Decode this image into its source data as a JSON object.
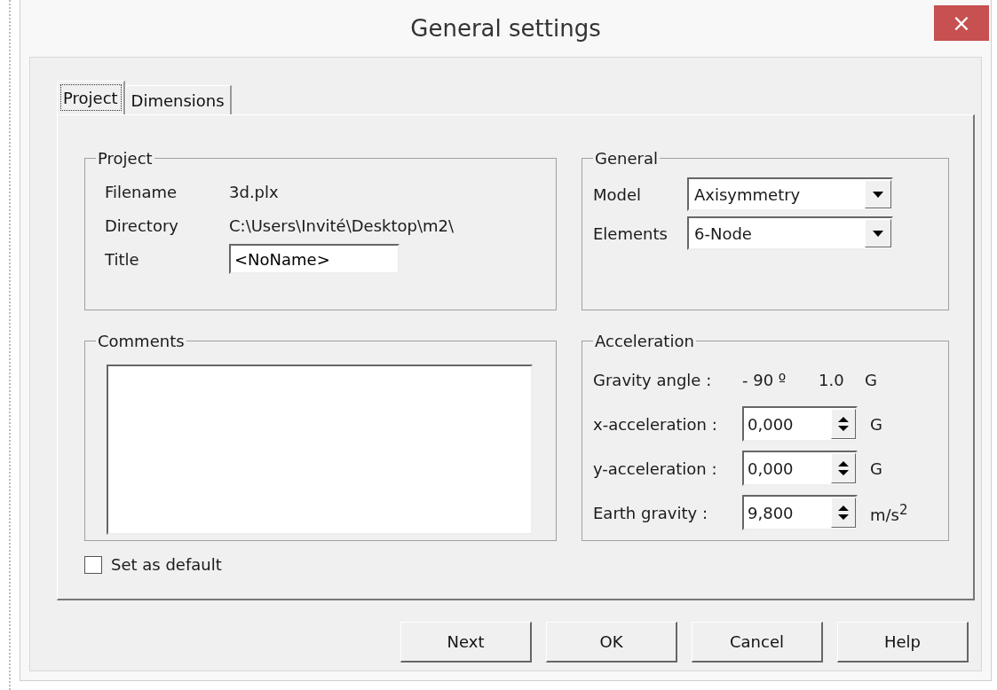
{
  "window": {
    "title": "General settings",
    "close": "×"
  },
  "tabs": [
    {
      "label": "Project",
      "selected": true
    },
    {
      "label": "Dimensions",
      "selected": false
    }
  ],
  "project": {
    "legend": "Project",
    "rows": [
      {
        "label": "Filename",
        "value": "3d.plx",
        "kind": "text"
      },
      {
        "label": "Directory",
        "value": "C:\\Users\\Invité\\Desktop\\m2\\",
        "kind": "text"
      },
      {
        "label": "Title",
        "value": "<NoName>",
        "kind": "input"
      }
    ]
  },
  "general": {
    "legend": "General",
    "fields": [
      {
        "label": "Model",
        "value": "Axisymmetry"
      },
      {
        "label": "Elements",
        "value": "6-Node"
      }
    ]
  },
  "comments": {
    "legend": "Comments"
  },
  "acceleration": {
    "legend": "Acceleration",
    "gravity_angle": {
      "label": "Gravity angle :",
      "angle": "- 90 º",
      "magnitude": "1.0",
      "unit": "G"
    },
    "fields": [
      {
        "label": "x-acceleration :",
        "value": "0,000",
        "unit": "G"
      },
      {
        "label": "y-acceleration :",
        "value": "0,000",
        "unit": "G"
      },
      {
        "label": "Earth gravity :",
        "value": "9,800",
        "unit": "m/s$^{2}$"
      }
    ]
  },
  "set_as_default": {
    "label": "Set as default",
    "checked": false
  },
  "buttons": [
    "Next",
    "OK",
    "Cancel",
    "Help"
  ]
}
